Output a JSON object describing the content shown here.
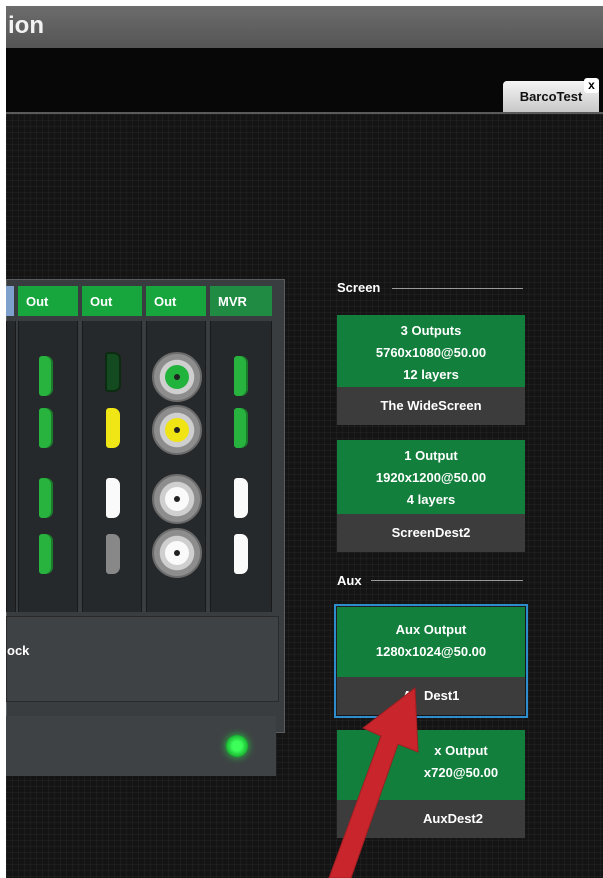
{
  "window": {
    "title_fragment": "ion"
  },
  "tabs": [
    {
      "label": "BarcoTest",
      "close": "x"
    }
  ],
  "connectors": {
    "columns": [
      {
        "label": "",
        "type": "edge"
      },
      {
        "label": "Out",
        "type": "out"
      },
      {
        "label": "Out",
        "type": "out"
      },
      {
        "label": "Out",
        "type": "out"
      },
      {
        "label": "MVR",
        "type": "mvr"
      }
    ],
    "genlock_label_fragment": "ock"
  },
  "screen_section": {
    "heading": "Screen",
    "destinations": [
      {
        "outputs": "3 Outputs",
        "resolution": "5760x1080@50.00",
        "layers": "12 layers",
        "name": "The WideScreen"
      },
      {
        "outputs": "1 Output",
        "resolution": "1920x1200@50.00",
        "layers": "4 layers",
        "name": "ScreenDest2"
      }
    ]
  },
  "aux_section": {
    "heading": "Aux",
    "destinations": [
      {
        "outputs": "Aux Output",
        "resolution": "1280x1024@50.00",
        "name": "AuxDest1",
        "name_visible": "A",
        "name_visible_tail": "Dest1",
        "selected": true
      },
      {
        "outputs_visible": "x Output",
        "resolution_visible": "x720@50.00",
        "name_visible": "AuxDest2"
      }
    ]
  },
  "colors": {
    "accent_green": "#127f3c",
    "column_green": "#17a63e",
    "selection_blue": "#2e8ecd",
    "arrow_red": "#c8262c"
  }
}
